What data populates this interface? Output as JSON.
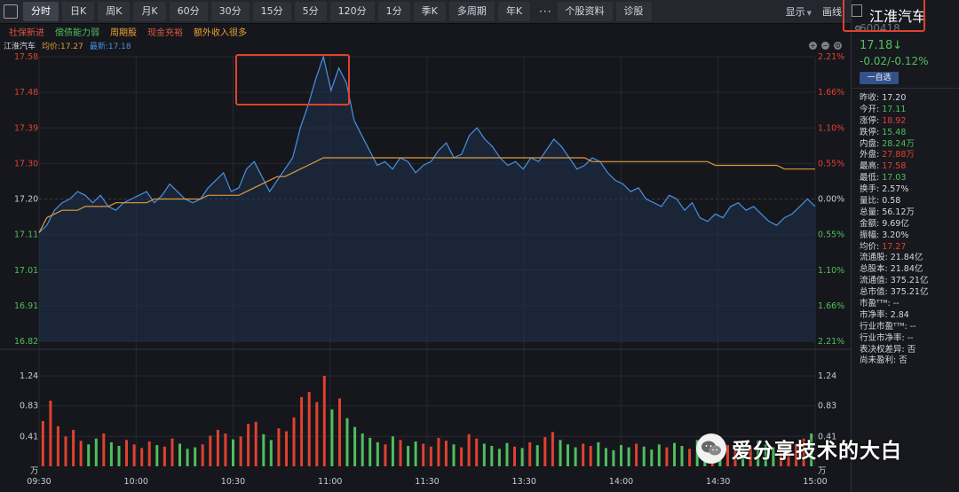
{
  "toolbar": {
    "tabs": [
      "分时",
      "日K",
      "周K",
      "月K",
      "60分",
      "30分",
      "15分",
      "5分",
      "120分",
      "1分",
      "季K",
      "多周期",
      "年K"
    ],
    "active_tab": 0,
    "more_label": "···",
    "tabs2": [
      "个股资料",
      "诊股"
    ],
    "display_label": "显示",
    "draw_label": "画线"
  },
  "tags": [
    {
      "text": "社保新进",
      "color": "#e0553f"
    },
    {
      "text": "偿债能力弱",
      "color": "#4fbf5d"
    },
    {
      "text": "周期股",
      "color": "#f0a030"
    },
    {
      "text": "现金充裕",
      "color": "#e0553f"
    },
    {
      "text": "额外收入很多",
      "color": "#f0a030"
    }
  ],
  "chart_header": {
    "name": "江淮汽车",
    "avg_label": "均价:17.27",
    "last_label": "最新:17.18",
    "avg_color": "#e09a3a",
    "last_color": "#4a90e2"
  },
  "side": {
    "name": "江淮汽车",
    "code": "600418",
    "price": "17.18↓",
    "change": "-0.02/-0.12%",
    "watch_label": "一自选",
    "quotes": [
      {
        "k": "昨收:",
        "v": "17.20",
        "c": "#d4d8df"
      },
      {
        "k": "今开:",
        "v": "17.11",
        "c": "#4fbf5d"
      },
      {
        "k": "涨停:",
        "v": "18.92",
        "c": "#e0412f"
      },
      {
        "k": "跌停:",
        "v": "15.48",
        "c": "#4fbf5d"
      },
      {
        "k": "内盘:",
        "v": "28.24万",
        "c": "#4fbf5d"
      },
      {
        "k": "外盘:",
        "v": "27.88万",
        "c": "#e0412f"
      },
      {
        "k": "最高:",
        "v": "17.58",
        "c": "#e0412f"
      },
      {
        "k": "最低:",
        "v": "17.03",
        "c": "#4fbf5d"
      },
      {
        "k": "换手:",
        "v": "2.57%",
        "c": "#d4d8df"
      },
      {
        "k": "量比:",
        "v": "0.58",
        "c": "#d4d8df"
      },
      {
        "k": "总量:",
        "v": "56.12万",
        "c": "#d4d8df"
      },
      {
        "k": "金额:",
        "v": "9.69亿",
        "c": "#d4d8df"
      },
      {
        "k": "振幅:",
        "v": "3.20%",
        "c": "#d4d8df"
      },
      {
        "k": "均价:",
        "v": "17.27",
        "c": "#e0412f"
      },
      {
        "k": "流通股:",
        "v": "21.84亿",
        "c": "#d4d8df"
      },
      {
        "k": "总股本:",
        "v": "21.84亿",
        "c": "#d4d8df"
      },
      {
        "k": "流通值:",
        "v": "375.21亿",
        "c": "#d4d8df"
      },
      {
        "k": "总市值:",
        "v": "375.21亿",
        "c": "#d4d8df"
      },
      {
        "k": "市盈ᵀᵀᴹ:",
        "v": "--",
        "c": "#d4d8df"
      },
      {
        "k": "市净率:",
        "v": "2.84",
        "c": "#d4d8df"
      },
      {
        "k": "行业市盈ᵀᵀᴹ:",
        "v": "--",
        "c": "#d4d8df"
      },
      {
        "k": "行业市净率:",
        "v": "--",
        "c": "#d4d8df"
      },
      {
        "k": "表决权差异:",
        "v": "否",
        "c": "#d4d8df"
      },
      {
        "k": "尚未盈利:",
        "v": "否",
        "c": "#d4d8df"
      }
    ]
  },
  "watermark": {
    "text": "爱分享技术的大白"
  },
  "colors": {
    "up": "#e0412f",
    "down": "#4fbf5d",
    "price_line": "#4a90e2",
    "avg_line": "#e09a3a"
  },
  "chart_data": {
    "type": "line",
    "x_ticks": [
      "09:30",
      "10:00",
      "10:30",
      "11:00",
      "11:30",
      "13:30",
      "14:00",
      "14:30",
      "15:00"
    ],
    "price_ticks_left": [
      "17.58",
      "17.48",
      "17.39",
      "17.30",
      "17.20",
      "17.11",
      "17.01",
      "16.91",
      "16.82"
    ],
    "pct_ticks_right": [
      "2.21%",
      "1.66%",
      "1.10%",
      "0.55%",
      "0.00%",
      "0.55%",
      "1.10%",
      "1.66%",
      "2.21%"
    ],
    "pre_close": 17.2,
    "ylim": [
      16.82,
      17.58
    ],
    "volume_ticks": [
      "1.24",
      "0.83",
      "0.41"
    ],
    "volume_unit": "万",
    "volume_ylim": [
      0,
      1.24
    ],
    "series": [
      {
        "name": "最新",
        "values": [
          17.11,
          17.13,
          17.17,
          17.19,
          17.2,
          17.22,
          17.21,
          17.19,
          17.21,
          17.18,
          17.17,
          17.19,
          17.2,
          17.21,
          17.22,
          17.19,
          17.21,
          17.24,
          17.22,
          17.2,
          17.19,
          17.2,
          17.23,
          17.25,
          17.27,
          17.22,
          17.23,
          17.28,
          17.3,
          17.26,
          17.22,
          17.25,
          17.28,
          17.31,
          17.39,
          17.45,
          17.52,
          17.58,
          17.49,
          17.55,
          17.51,
          17.41,
          17.37,
          17.33,
          17.29,
          17.3,
          17.28,
          17.31,
          17.3,
          17.27,
          17.29,
          17.3,
          17.33,
          17.35,
          17.31,
          17.32,
          17.37,
          17.39,
          17.36,
          17.34,
          17.31,
          17.29,
          17.3,
          17.28,
          17.31,
          17.3,
          17.33,
          17.36,
          17.34,
          17.31,
          17.28,
          17.29,
          17.31,
          17.3,
          17.27,
          17.25,
          17.24,
          17.22,
          17.23,
          17.2,
          17.19,
          17.18,
          17.21,
          17.2,
          17.17,
          17.19,
          17.15,
          17.14,
          17.16,
          17.15,
          17.18,
          17.19,
          17.17,
          17.18,
          17.16,
          17.14,
          17.13,
          17.15,
          17.16,
          17.18,
          17.2,
          17.18
        ]
      },
      {
        "name": "均价",
        "values": [
          17.11,
          17.15,
          17.16,
          17.17,
          17.17,
          17.17,
          17.18,
          17.18,
          17.18,
          17.18,
          17.19,
          17.19,
          17.19,
          17.19,
          17.19,
          17.2,
          17.2,
          17.2,
          17.2,
          17.2,
          17.2,
          17.2,
          17.21,
          17.21,
          17.21,
          17.21,
          17.21,
          17.22,
          17.23,
          17.24,
          17.25,
          17.26,
          17.26,
          17.27,
          17.28,
          17.29,
          17.3,
          17.31,
          17.31,
          17.31,
          17.31,
          17.31,
          17.31,
          17.31,
          17.31,
          17.31,
          17.31,
          17.31,
          17.31,
          17.31,
          17.31,
          17.31,
          17.31,
          17.31,
          17.31,
          17.31,
          17.31,
          17.31,
          17.31,
          17.31,
          17.31,
          17.31,
          17.31,
          17.31,
          17.31,
          17.31,
          17.31,
          17.31,
          17.31,
          17.31,
          17.31,
          17.31,
          17.3,
          17.3,
          17.3,
          17.3,
          17.3,
          17.3,
          17.3,
          17.3,
          17.3,
          17.3,
          17.3,
          17.3,
          17.3,
          17.3,
          17.3,
          17.3,
          17.29,
          17.29,
          17.29,
          17.29,
          17.29,
          17.29,
          17.29,
          17.29,
          17.29,
          17.28,
          17.28,
          17.28,
          17.28,
          17.28
        ]
      }
    ],
    "volume": [
      0.62,
      0.9,
      0.55,
      0.41,
      0.5,
      0.35,
      0.3,
      0.38,
      0.45,
      0.33,
      0.28,
      0.36,
      0.3,
      0.25,
      0.34,
      0.29,
      0.27,
      0.38,
      0.31,
      0.24,
      0.26,
      0.3,
      0.42,
      0.5,
      0.45,
      0.37,
      0.41,
      0.58,
      0.61,
      0.44,
      0.36,
      0.52,
      0.48,
      0.67,
      0.95,
      1.02,
      0.88,
      1.24,
      0.78,
      0.93,
      0.66,
      0.54,
      0.45,
      0.39,
      0.33,
      0.3,
      0.41,
      0.36,
      0.28,
      0.34,
      0.31,
      0.27,
      0.39,
      0.35,
      0.3,
      0.26,
      0.44,
      0.38,
      0.31,
      0.28,
      0.24,
      0.32,
      0.27,
      0.25,
      0.33,
      0.29,
      0.4,
      0.47,
      0.36,
      0.3,
      0.26,
      0.31,
      0.28,
      0.33,
      0.25,
      0.22,
      0.29,
      0.26,
      0.31,
      0.27,
      0.23,
      0.3,
      0.26,
      0.32,
      0.28,
      0.24,
      0.36,
      0.3,
      0.27,
      0.33,
      0.29,
      0.25,
      0.31,
      0.28,
      0.35,
      0.3,
      0.26,
      0.34,
      0.29,
      0.31,
      0.38,
      0.45
    ]
  }
}
